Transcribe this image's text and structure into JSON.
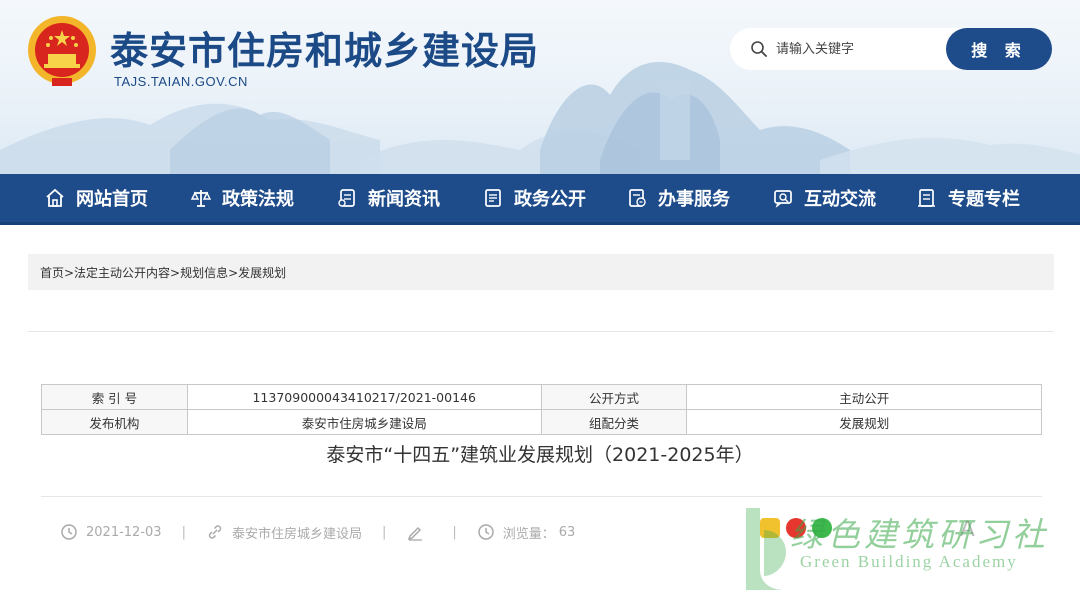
{
  "header": {
    "site_title": "泰安市住房和城乡建设局",
    "site_domain": "TAJS.TAIAN.GOV.CN",
    "search_placeholder": "请输入关键字",
    "search_button": "搜 索"
  },
  "nav": {
    "items": [
      {
        "label": "网站首页",
        "icon": "home-icon"
      },
      {
        "label": "政策法规",
        "icon": "scale-icon"
      },
      {
        "label": "新闻资讯",
        "icon": "news-icon"
      },
      {
        "label": "政务公开",
        "icon": "document-icon"
      },
      {
        "label": "办事服务",
        "icon": "service-icon"
      },
      {
        "label": "互动交流",
        "icon": "chat-icon"
      },
      {
        "label": "专题专栏",
        "icon": "column-icon"
      }
    ]
  },
  "breadcrumb": "首页>法定主动公开内容>规划信息>发展规划",
  "meta": {
    "index_label": "索 引 号",
    "index_value": "113709000043410217/2021-00146",
    "open_mode_label": "公开方式",
    "open_mode_value": "主动公开",
    "publisher_label": "发布机构",
    "publisher_value": "泰安市住房城乡建设局",
    "category_label": "组配分类",
    "category_value": "发展规划"
  },
  "document": {
    "title": "泰安市“十四五”建筑业发展规划（2021-2025年）",
    "date": "2021-12-03",
    "source": "泰安市住房城乡建设局",
    "views_label": "浏览量：",
    "views": "63"
  },
  "font_size_label": "A",
  "watermark": {
    "cn": "绿色建筑研习社",
    "en": "Green Building Academy"
  },
  "colors": {
    "brand_blue": "#1e4c8a",
    "watermark_green": "#3aa84a"
  }
}
